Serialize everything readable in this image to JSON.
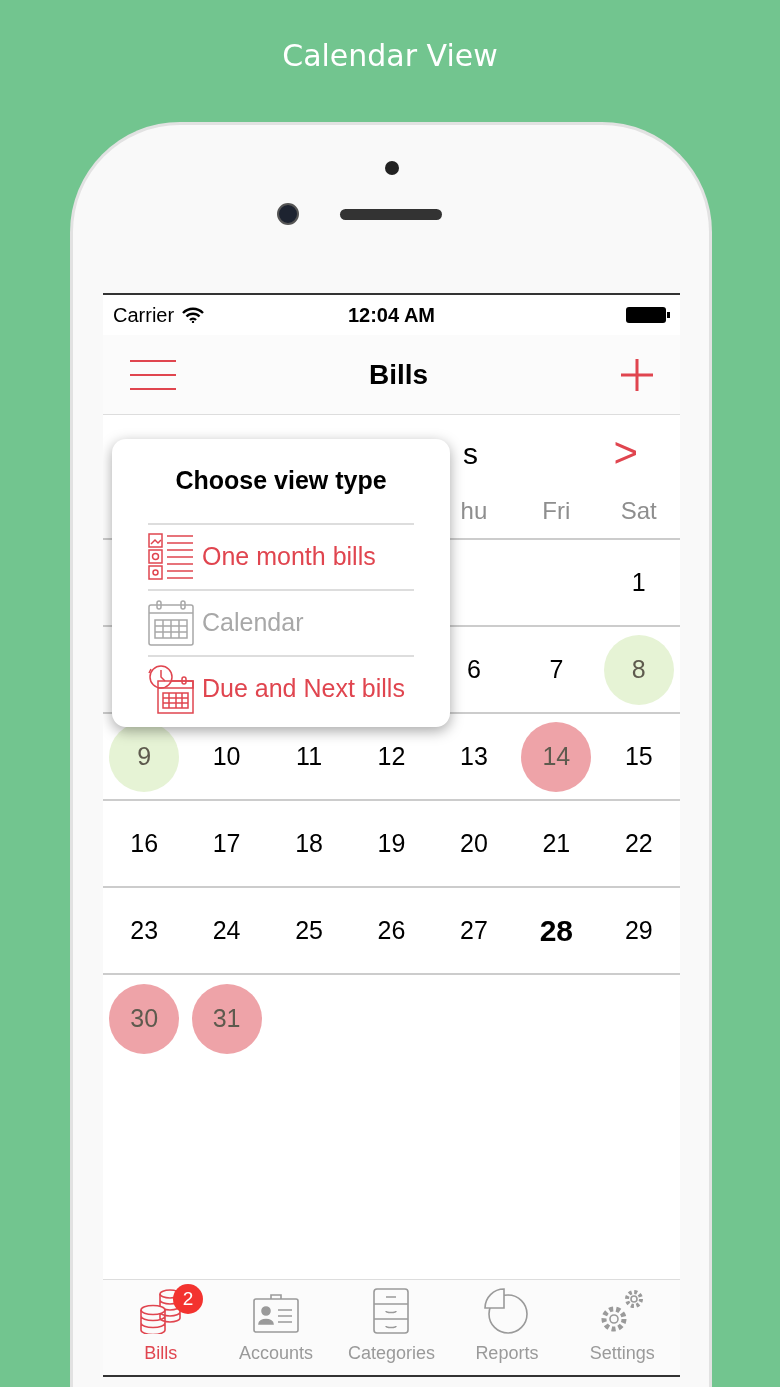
{
  "caption": "Calendar View",
  "status_bar": {
    "carrier": "Carrier",
    "time": "12:04 AM"
  },
  "nav": {
    "title": "Bills"
  },
  "calendar": {
    "month_title": "s",
    "next": ">",
    "weekdays": [
      "hu",
      "Fri",
      "Sat"
    ],
    "rows": [
      {
        "days": [
          {
            "day": "1",
            "today": false
          }
        ]
      },
      {
        "days": [
          {
            "day": "6",
            "today": false
          },
          {
            "day": "7",
            "today": false
          },
          {
            "day": "8",
            "today": false,
            "color": "#e6f3d5"
          }
        ]
      },
      {
        "days": [
          {
            "day": "9",
            "today": false,
            "color": "#e6f3d5"
          },
          {
            "day": "10",
            "today": false
          },
          {
            "day": "11",
            "today": false
          },
          {
            "day": "12",
            "today": false
          },
          {
            "day": "13",
            "today": false
          },
          {
            "day": "14",
            "today": false,
            "color": "#eea3a8"
          },
          {
            "day": "15",
            "today": false
          }
        ]
      },
      {
        "days": [
          {
            "day": "16",
            "today": false
          },
          {
            "day": "17",
            "today": false
          },
          {
            "day": "18",
            "today": false
          },
          {
            "day": "19",
            "today": false
          },
          {
            "day": "20",
            "today": false
          },
          {
            "day": "21",
            "today": false
          },
          {
            "day": "22",
            "today": false
          }
        ]
      },
      {
        "days": [
          {
            "day": "23",
            "today": false
          },
          {
            "day": "24",
            "today": false
          },
          {
            "day": "25",
            "today": false
          },
          {
            "day": "26",
            "today": false
          },
          {
            "day": "27",
            "today": false
          },
          {
            "day": "28",
            "today": true
          },
          {
            "day": "29",
            "today": false
          }
        ]
      },
      {
        "days": [
          {
            "day": "30",
            "today": false,
            "color": "#eea3a8"
          },
          {
            "day": "31",
            "today": false,
            "color": "#eea3a8"
          }
        ]
      }
    ]
  },
  "popup": {
    "title": "Choose view type",
    "items": [
      {
        "kind": "list",
        "label": "One month bills",
        "selected": false
      },
      {
        "kind": "calendar",
        "label": "Calendar",
        "selected": true
      },
      {
        "kind": "due",
        "label": "Due and Next bills",
        "selected": false
      }
    ]
  },
  "tab_bar": [
    {
      "kind": "bills",
      "label": "Bills",
      "selected": true,
      "badge": "2"
    },
    {
      "kind": "accounts",
      "label": "Accounts",
      "selected": false
    },
    {
      "kind": "categories",
      "label": "Categories",
      "selected": false
    },
    {
      "kind": "reports",
      "label": "Reports",
      "selected": false
    },
    {
      "kind": "settings",
      "label": "Settings",
      "selected": false
    }
  ]
}
